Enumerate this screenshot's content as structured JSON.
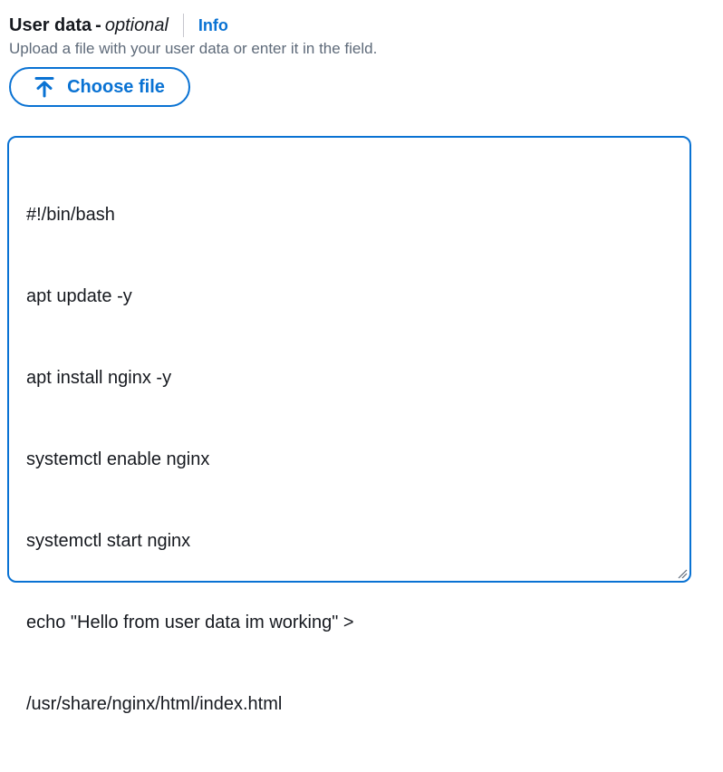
{
  "field": {
    "label": "User data",
    "dash": "-",
    "optional": "optional",
    "info_link": "Info",
    "description": "Upload a file with your user data or enter it in the field."
  },
  "upload": {
    "button_label": "Choose file",
    "icon": "upload-arrow-icon"
  },
  "editor": {
    "lines": [
      "#!/bin/bash",
      "apt update -y",
      "apt install nginx -y",
      "systemctl enable nginx",
      "systemctl start nginx",
      "echo \"Hello from user data im working\" >",
      "/usr/share/nginx/html/index.html"
    ]
  },
  "colors": {
    "accent": "#0972d3",
    "text": "#16191f",
    "secondary_text": "#5f6b7a",
    "spellcheck": "#d91515"
  }
}
